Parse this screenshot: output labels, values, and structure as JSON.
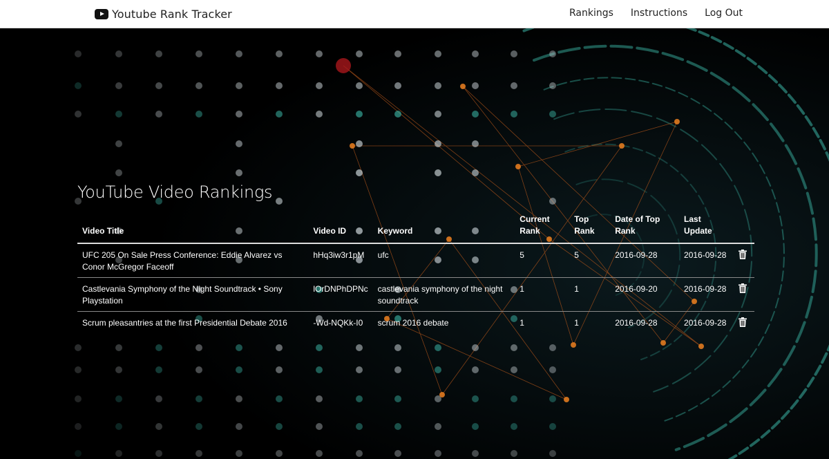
{
  "navbar": {
    "brand": "Youtube Rank Tracker",
    "links": [
      "Rankings",
      "Instructions",
      "Log Out"
    ]
  },
  "main": {
    "title": "YouTube Video Rankings",
    "columns": {
      "video_title": "Video Title",
      "video_id": "Video ID",
      "keyword": "Keyword",
      "current_rank_1": "Current",
      "current_rank_2": "Rank",
      "top_rank_1": "Top",
      "top_rank_2": "Rank",
      "date_top_1": "Date of Top",
      "date_top_2": "Rank",
      "last_update_1": "Last",
      "last_update_2": "Update"
    },
    "rows": [
      {
        "title": "UFC 205 On Sale Press Conference: Eddie Alvarez vs Conor McGregor Faceoff",
        "video_id": "hHq3iw3r1pM",
        "keyword": "ufc",
        "current_rank": "5",
        "top_rank": "5",
        "date_top_rank": "2016-09-28",
        "last_update": "2016-09-28"
      },
      {
        "title": "Castlevania Symphony of the Night Soundtrack • Sony Playstation",
        "video_id": "lOrDNPhDPNc",
        "keyword": "castlevania symphony of the night soundtrack",
        "current_rank": "1",
        "top_rank": "1",
        "date_top_rank": "2016-09-20",
        "last_update": "2016-09-28"
      },
      {
        "title": "Scrum pleasantries at the first Presidential Debate 2016",
        "video_id": "-Wd-NQKk-I0",
        "keyword": "scrum 2016 debate",
        "current_rank": "1",
        "top_rank": "1",
        "date_top_rank": "2016-09-28",
        "last_update": "2016-09-28"
      }
    ]
  },
  "colors": {
    "navbar_bg": "#ffffff",
    "page_bg": "#000000",
    "accent_teal": "#3fc1b0",
    "accent_orange": "#e07a1f"
  }
}
